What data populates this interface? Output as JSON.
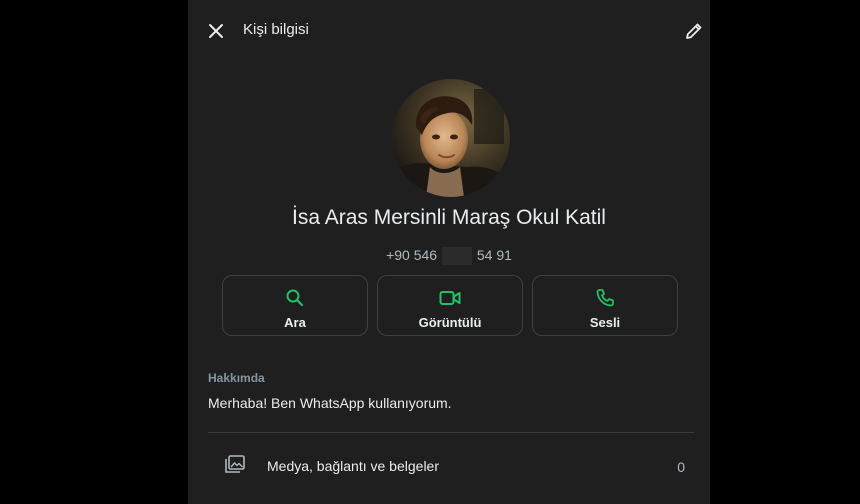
{
  "header": {
    "title": "Kişi bilgisi"
  },
  "profile": {
    "name": "İsa Aras Mersinli Maraş Okul Katil",
    "phone_start": "+90 546",
    "phone_end": "54 91"
  },
  "actions": [
    {
      "label": "Ara",
      "icon": "search-icon"
    },
    {
      "label": "Görüntülü",
      "icon": "video-icon"
    },
    {
      "label": "Sesli",
      "icon": "phone-icon"
    }
  ],
  "about": {
    "label": "Hakkımda",
    "text": "Merhaba! Ben WhatsApp kullanıyorum."
  },
  "media": {
    "label": "Medya, bağlantı ve belgeler",
    "count": "0"
  },
  "colors": {
    "panel_bg": "#1f1f1f",
    "accent_green": "#21c063",
    "text_primary": "#e9edef",
    "text_secondary": "#8696a0"
  }
}
